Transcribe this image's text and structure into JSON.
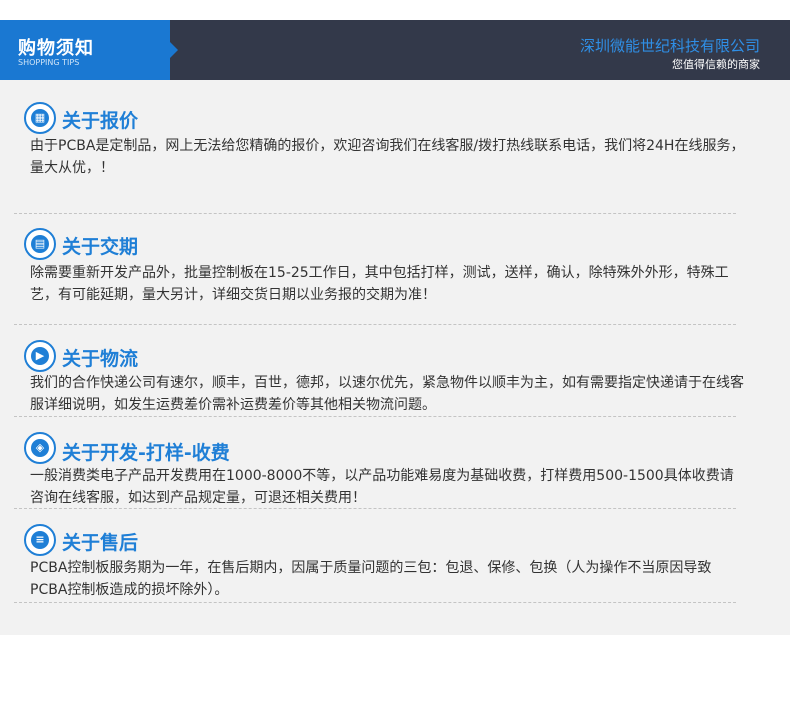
{
  "header": {
    "title": "购物须知",
    "subtitle": "SHOPPING TIPS",
    "company": "深圳微能世纪科技有限公司",
    "slogan": "您值得信赖的商家"
  },
  "sections": [
    {
      "icon": "grid-icon",
      "title": "关于报价",
      "body": "由于PCBA是定制品，网上无法给您精确的报价，欢迎咨询我们在线客服/拨打热线联系电话，我们将24H在线服务，量大从优，！"
    },
    {
      "icon": "delivery-schedule-icon",
      "title": "关于交期",
      "body": "除需要重新开发产品外，批量控制板在15-25工作日，其中包括打样，测试，送样，确认，除特殊外外形，特殊工艺，有可能延期，量大另计，详细交货日期以业务报的交期为准！"
    },
    {
      "icon": "truck-icon",
      "title": "关于物流",
      "body": "我们的合作快递公司有速尔，顺丰，百世，德邦，以速尔优先，紧急物件以顺丰为主，如有需要指定快递请于在线客服详细说明，如发生运费差价需补运费差价等其他相关物流问题。"
    },
    {
      "icon": "layers-icon",
      "title": "关于开发-打样-收费",
      "body": "一般消费类电子产品开发费用在1000-8000不等，以产品功能难易度为基础收费，打样费用500-1500具体收费请咨询在线客服，如达到产品规定量，可退还相关费用！"
    },
    {
      "icon": "document-icon",
      "title": "关于售后",
      "body": "PCBA控制板服务期为一年，在售后期内，因属于质量问题的三包：包退、保修、包换（人为操作不当原因导致PCBA控制板造成的损坏除外）。"
    }
  ],
  "colors": {
    "accent": "#1f7fd6",
    "header_bg": "#33394a",
    "panel_bg": "#f2f2f2"
  }
}
